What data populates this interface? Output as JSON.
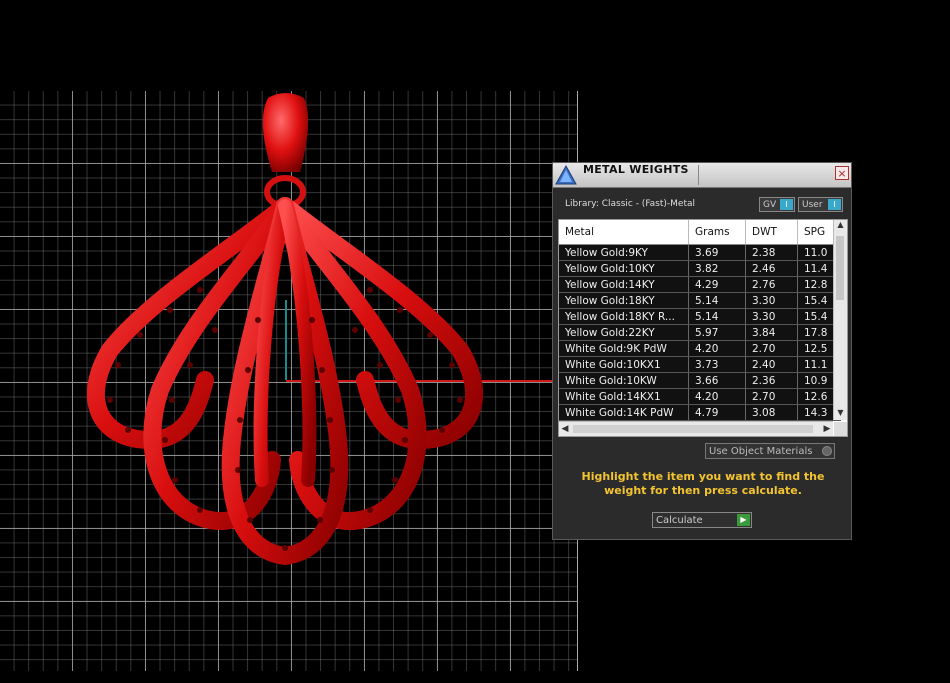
{
  "panel": {
    "title": "METAL WEIGHTS",
    "close_symbol": "×",
    "library_label": "Library: Classic - (Fast)-Metal",
    "toggles": [
      {
        "label": "GV",
        "knob": "I"
      },
      {
        "label": "User",
        "knob": "I"
      }
    ],
    "table": {
      "headers": [
        "Metal",
        "Grams",
        "DWT",
        "SPG"
      ],
      "rows": [
        [
          "Yellow Gold:9KY",
          "3.69",
          "2.38",
          "11.0"
        ],
        [
          "Yellow Gold:10KY",
          "3.82",
          "2.46",
          "11.4"
        ],
        [
          "Yellow Gold:14KY",
          "4.29",
          "2.76",
          "12.8"
        ],
        [
          "Yellow Gold:18KY",
          "5.14",
          "3.30",
          "15.4"
        ],
        [
          "Yellow Gold:18KY R...",
          "5.14",
          "3.30",
          "15.4"
        ],
        [
          "Yellow Gold:22KY",
          "5.97",
          "3.84",
          "17.8"
        ],
        [
          "White Gold:9K PdW",
          "4.20",
          "2.70",
          "12.5"
        ],
        [
          "White Gold:10KX1",
          "3.73",
          "2.40",
          "11.1"
        ],
        [
          "White Gold:10KW",
          "3.66",
          "2.36",
          "10.9"
        ],
        [
          "White Gold:14KX1",
          "4.20",
          "2.70",
          "12.6"
        ],
        [
          "White Gold:14K PdW",
          "4.79",
          "3.08",
          "14.3"
        ]
      ]
    },
    "use_object_materials": "Use Object Materials",
    "hint": "Highlight the item you want to find the weight for then press calculate.",
    "calculate_label": "Calculate",
    "icons": {
      "logo": "app-logo-icon",
      "close": "close-icon",
      "calculate": "play-icon"
    }
  },
  "colors": {
    "pendant": "#e01010",
    "hint": "#f4c430",
    "x_axis": "#d01818",
    "y_axis": "#1b8a8a",
    "toggle_knob": "#3aa8c8",
    "calculate_button": "#3b9a3b"
  }
}
